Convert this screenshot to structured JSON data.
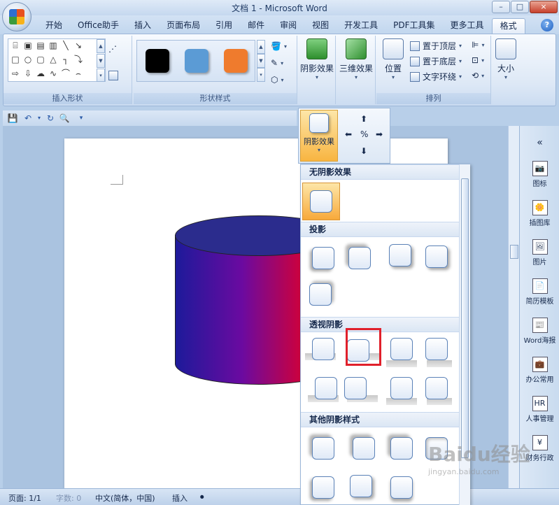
{
  "window": {
    "title": "文档 1 - Microsoft Word",
    "min": "–",
    "max": "□",
    "close": "×"
  },
  "tabs": [
    "开始",
    "Office助手",
    "插入",
    "页面布局",
    "引用",
    "邮件",
    "审阅",
    "视图",
    "开发工具",
    "PDF工具集",
    "更多工具",
    "格式"
  ],
  "active_tab": "格式",
  "help": "?",
  "ribbon": {
    "insert_shapes_label": "插入形状",
    "shape_styles_label": "形状样式",
    "shadow_effects": "阴影效果",
    "threed_effects": "三维效果",
    "position": "位置",
    "bring_front": "置于顶层",
    "send_back": "置于底层",
    "text_wrap": "文字环绕",
    "arrange_label": "排列",
    "size": "大小",
    "swatch_colors": [
      "#000000",
      "#5b9bd5",
      "#ef7b2d"
    ]
  },
  "popup": {
    "shadow_button": "阴影效果"
  },
  "dropdown": {
    "no_shadow": "无阴影效果",
    "drop_shadow": "投影",
    "perspective": "透视阴影",
    "other": "其他阴影样式"
  },
  "right_panel": [
    "图标",
    "插图库",
    "图片",
    "简历模板",
    "Word海报",
    "办公常用",
    "人事管理",
    "财务行政"
  ],
  "status": {
    "page": "页面: 1/1",
    "words": "字数: 0",
    "lang": "中文(简体，中国)",
    "mode": "插入"
  },
  "watermark": {
    "brand": "Baidu经验",
    "url": "jingyan.baidu.com"
  }
}
